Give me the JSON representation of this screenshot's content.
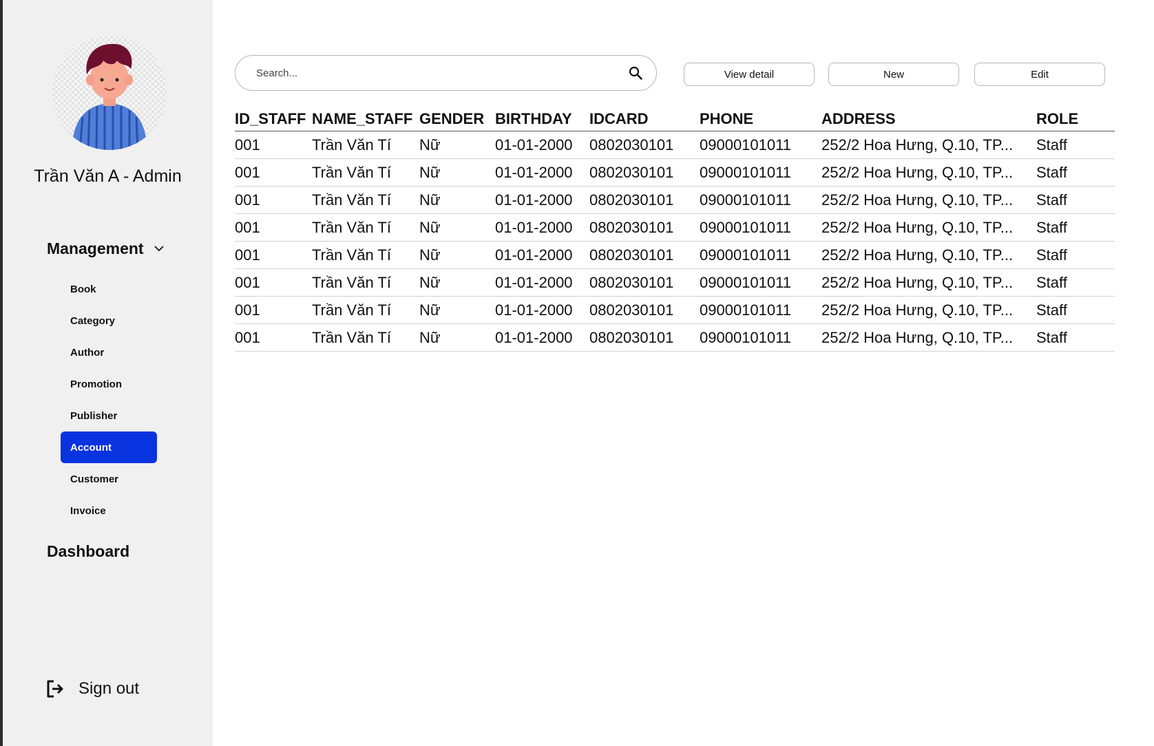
{
  "sidebar": {
    "user_name": "Trần Văn A - Admin",
    "management_label": "Management",
    "menu": [
      {
        "label": "Book",
        "active": false
      },
      {
        "label": "Category",
        "active": false
      },
      {
        "label": "Author",
        "active": false
      },
      {
        "label": "Promotion",
        "active": false
      },
      {
        "label": "Publisher",
        "active": false
      },
      {
        "label": "Account",
        "active": true
      },
      {
        "label": "Customer",
        "active": false
      },
      {
        "label": "Invoice",
        "active": false
      }
    ],
    "dashboard_label": "Dashboard",
    "signout_label": "Sign out"
  },
  "search": {
    "placeholder": "Search..."
  },
  "toolbar": {
    "view_detail_label": "View detail",
    "new_label": "New",
    "edit_label": "Edit"
  },
  "table": {
    "columns": [
      "ID_STAFF",
      "NAME_STAFF",
      "GENDER",
      "BIRTHDAY",
      "IDCARD",
      "PHONE",
      "ADDRESS",
      "ROLE"
    ],
    "rows": [
      [
        "001",
        "Trần Văn Tí",
        "Nữ",
        "01-01-2000",
        "0802030101",
        "09000101011",
        "252/2 Hoa Hưng, Q.10, TP...",
        "Staff"
      ],
      [
        "001",
        "Trần Văn Tí",
        "Nữ",
        "01-01-2000",
        "0802030101",
        "09000101011",
        "252/2 Hoa Hưng, Q.10, TP...",
        "Staff"
      ],
      [
        "001",
        "Trần Văn Tí",
        "Nữ",
        "01-01-2000",
        "0802030101",
        "09000101011",
        "252/2 Hoa Hưng, Q.10, TP...",
        "Staff"
      ],
      [
        "001",
        "Trần Văn Tí",
        "Nữ",
        "01-01-2000",
        "0802030101",
        "09000101011",
        "252/2 Hoa Hưng, Q.10, TP...",
        "Staff"
      ],
      [
        "001",
        "Trần Văn Tí",
        "Nữ",
        "01-01-2000",
        "0802030101",
        "09000101011",
        "252/2 Hoa Hưng, Q.10, TP...",
        "Staff"
      ],
      [
        "001",
        "Trần Văn Tí",
        "Nữ",
        "01-01-2000",
        "0802030101",
        "09000101011",
        "252/2 Hoa Hưng, Q.10, TP...",
        "Staff"
      ],
      [
        "001",
        "Trần Văn Tí",
        "Nữ",
        "01-01-2000",
        "0802030101",
        "09000101011",
        "252/2 Hoa Hưng, Q.10, TP...",
        "Staff"
      ],
      [
        "001",
        "Trần Văn Tí",
        "Nữ",
        "01-01-2000",
        "0802030101",
        "09000101011",
        "252/2 Hoa Hưng, Q.10, TP...",
        "Staff"
      ]
    ]
  },
  "colors": {
    "sidebar_bg": "#f0f0f0",
    "active_item_bg": "#0a33e0",
    "active_item_text": "#ffffff"
  },
  "icons": {
    "avatar": "avatar-icon",
    "dropdown": "chevron-down-icon",
    "search": "search-icon",
    "signout": "sign-out-icon"
  }
}
